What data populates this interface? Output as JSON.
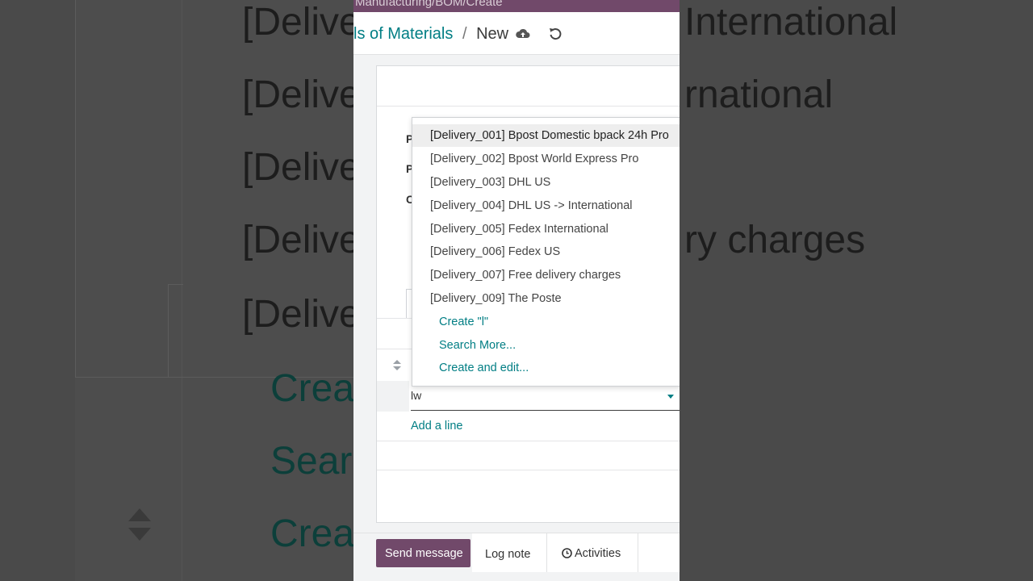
{
  "background": {
    "texts": [
      "[Delive",
      "[Delive",
      "[Delive",
      "[Delive",
      "[Delive"
    ],
    "right_texts": [
      "International",
      "rnational",
      "ry charges"
    ],
    "action_texts": [
      "Creat",
      "Searc",
      "Creat"
    ]
  },
  "topbar": {
    "title": "Manufacturing/BOM/Create"
  },
  "header": {
    "breadcrumb_parent": "ls of Materials",
    "breadcrumb_separator": "/",
    "breadcrumb_current": "New",
    "save_icon": "cloud-upload-icon",
    "discard_icon": "undo-icon"
  },
  "form": {
    "labels": [
      "P",
      "P",
      "C"
    ]
  },
  "line": {
    "input_value": "lw",
    "add_line": "Add a line"
  },
  "dropdown": {
    "options": [
      "[Delivery_001] Bpost Domestic bpack 24h Pro",
      "[Delivery_002] Bpost World Express Pro",
      "[Delivery_003] DHL US",
      "[Delivery_004] DHL US -> International",
      "[Delivery_005] Fedex International",
      "[Delivery_006] Fedex US",
      "[Delivery_007] Free delivery charges",
      "[Delivery_009] The Poste"
    ],
    "actions": [
      "Create \"l\"",
      "Search More...",
      "Create and edit..."
    ]
  },
  "chatter": {
    "send_message": "Send message",
    "log_note": "Log note",
    "activities": "Activities"
  },
  "colors": {
    "accent": "#017e84",
    "brand": "#71496a"
  }
}
